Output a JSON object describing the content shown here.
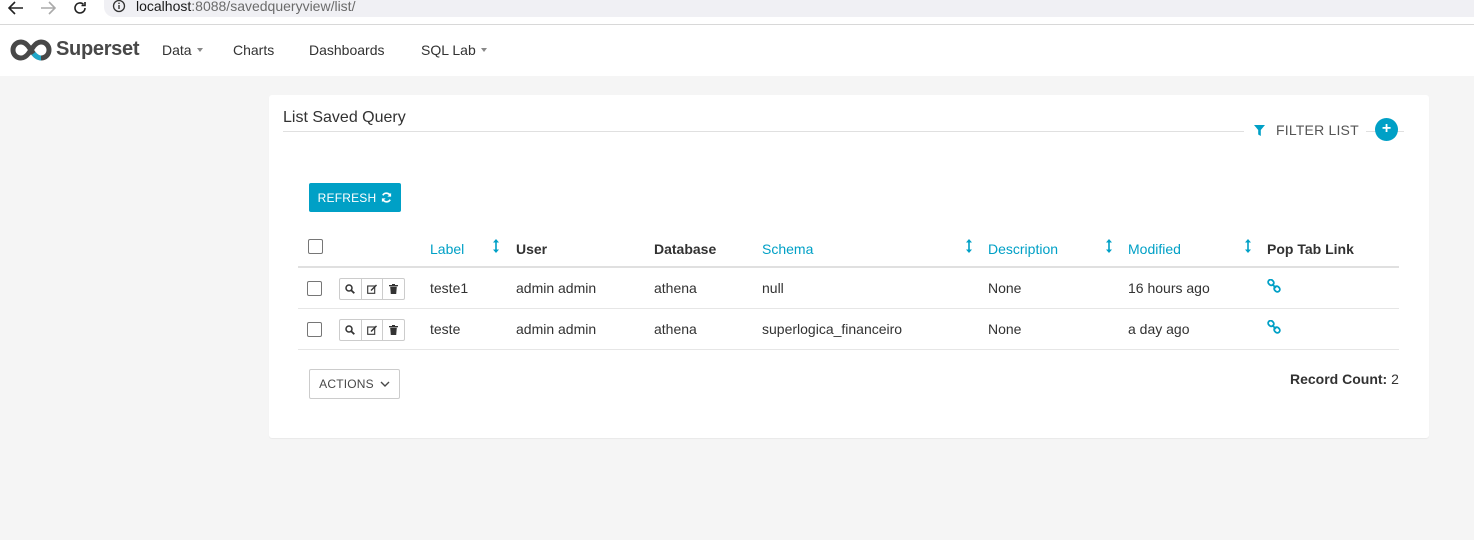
{
  "browser": {
    "url_host": "localhost",
    "url_rest": ":8088/savedqueryview/list/"
  },
  "navbar": {
    "brand": "Superset",
    "items": [
      {
        "label": "Data",
        "dropdown": true
      },
      {
        "label": "Charts",
        "dropdown": false
      },
      {
        "label": "Dashboards",
        "dropdown": false
      },
      {
        "label": "SQL Lab",
        "dropdown": true
      }
    ]
  },
  "panel": {
    "title": "List Saved Query",
    "filter_label": "FILTER LIST",
    "add_label": "+",
    "refresh_label": "REFRESH",
    "actions_label": "ACTIONS",
    "record_count_label": "Record Count:",
    "record_count_value": "2"
  },
  "table": {
    "columns": [
      "Label",
      "User",
      "Database",
      "Schema",
      "Description",
      "Modified",
      "Pop Tab Link"
    ],
    "rows": [
      {
        "label": "teste1",
        "user": "admin admin",
        "database": "athena",
        "schema": "null",
        "description": "None",
        "modified": "16 hours ago"
      },
      {
        "label": "teste",
        "user": "admin admin",
        "database": "athena",
        "schema": "superlogica_financeiro",
        "description": "None",
        "modified": "a day ago"
      }
    ]
  },
  "colors": {
    "accent": "#00a0c6",
    "background": "#f5f5f5",
    "text": "#323232"
  }
}
